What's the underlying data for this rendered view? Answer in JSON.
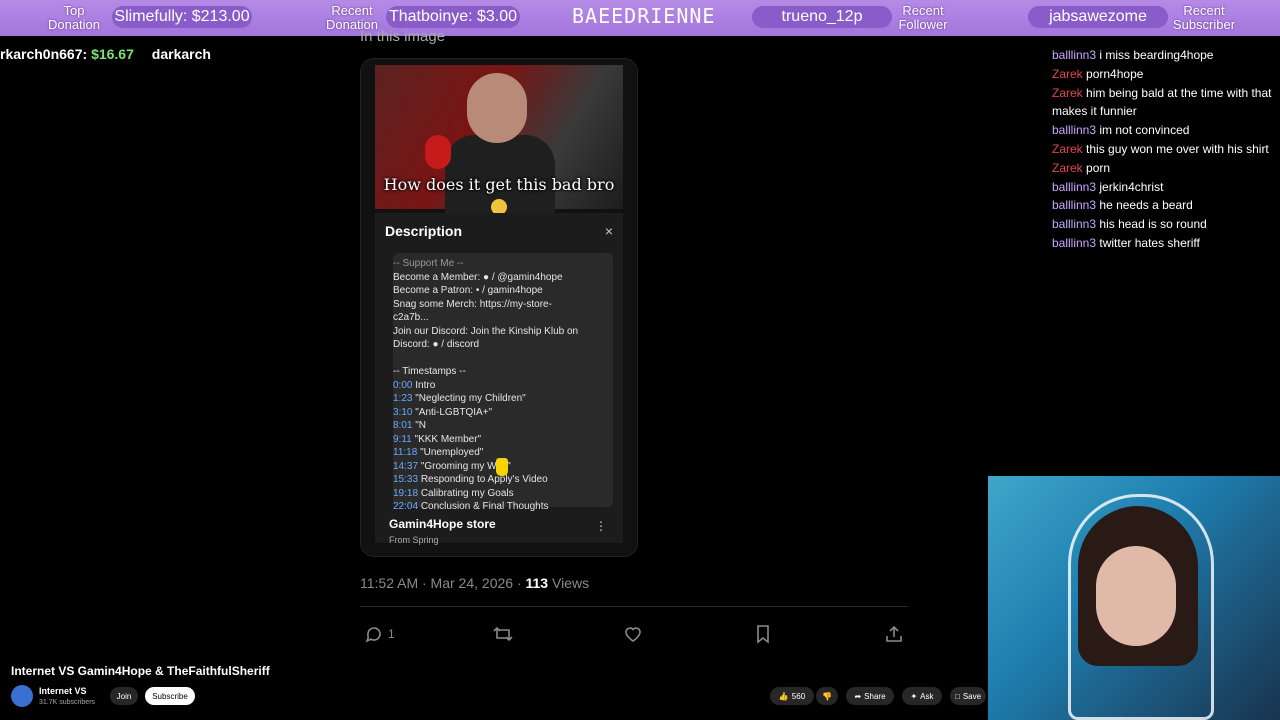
{
  "banner": {
    "top_donation_label": "Top\nDonation",
    "top_donation_value": "Slimefully: $213.00",
    "recent_donation_label": "Recent\nDonation",
    "recent_donation_value": "Thatboinye: $3.00",
    "streamer": "BAEEDRIENNE",
    "recent_follower_value": "trueno_12p",
    "recent_follower_label": "Recent\nFollower",
    "recent_subscriber_value": "jabsawezome",
    "recent_subscriber_label": "Recent\nSubscriber"
  },
  "ticker": {
    "name": "rkarch0n667:",
    "amount": "$16.67",
    "next": "darkarch"
  },
  "tweet": {
    "partial_heading": "In this image",
    "video_caption": "How does it get this bad bro",
    "description_title": "Description",
    "close": "×",
    "lines": [
      "-- Support Me --",
      "Become a Member: ● / @gamin4hope",
      "Become a Patron: • / gamin4hope",
      "Snag some Merch: https://my-store-",
      "c2a7b...",
      "Join our Discord: Join the Kinship Klub on",
      "Discord: ● / discord",
      "",
      "-- Timestamps --"
    ],
    "timestamps": [
      {
        "time": "0:00",
        "label": "Intro"
      },
      {
        "time": "1:23",
        "label": "\"Neglecting my Children\""
      },
      {
        "time": "3:10",
        "label": "\"Anti-LGBTQIA+\""
      },
      {
        "time": "8:01",
        "label": "\"N"
      },
      {
        "time": "9:11",
        "label": "\"KKK Member\""
      },
      {
        "time": "11:18",
        "label": "\"Unemployed\""
      },
      {
        "time": "14:37",
        "label": "\"Grooming my Wife\""
      },
      {
        "time": "15:33",
        "label": "Responding to Apply's Video"
      },
      {
        "time": "19:18",
        "label": "Calibrating my Goals"
      },
      {
        "time": "22:04",
        "label": "Conclusion & Final Thoughts"
      }
    ],
    "store_title": "Gamin4Hope store",
    "store_sub": "From Spring",
    "store_menu": "⋮",
    "timestamp": "11:52 AM · Mar 24, 2026 · ",
    "views_count": "113",
    "views_label": " Views",
    "actions": {
      "reply_count": "1"
    }
  },
  "chat": [
    {
      "user": "balllinn3",
      "kind": "b",
      "text": "i miss bearding4hope"
    },
    {
      "user": "Zarek",
      "kind": "z",
      "text": "porn4hope"
    },
    {
      "user": "Zarek",
      "kind": "z",
      "text": "him being bald at the time with that makes it funnier"
    },
    {
      "user": "balllinn3",
      "kind": "b",
      "text": "im not convinced"
    },
    {
      "user": "Zarek",
      "kind": "z",
      "text": "this guy won me over with his shirt"
    },
    {
      "user": "Zarek",
      "kind": "z",
      "text": "porn"
    },
    {
      "user": "balllinn3",
      "kind": "b",
      "text": "jerkin4christ"
    },
    {
      "user": "balllinn3",
      "kind": "b",
      "text": "he needs a beard"
    },
    {
      "user": "balllinn3",
      "kind": "b",
      "text": "his head is so round"
    },
    {
      "user": "balllinn3",
      "kind": "b",
      "text": "twitter hates sheriff"
    }
  ],
  "youtube": {
    "title": "Internet VS Gamin4Hope & TheFaithfulSheriff",
    "channel": "Internet VS",
    "subscribers": "31.7K subscribers",
    "join": "Join",
    "subscribe": "Subscribe",
    "likes": "560",
    "share": "Share",
    "ask": "Ask",
    "save": "Save"
  },
  "colors": {
    "banner": "#a97ee0",
    "chat_user_b": "#c7a6ff",
    "chat_user_z": "#e0474c",
    "link": "#6aa9ff"
  }
}
